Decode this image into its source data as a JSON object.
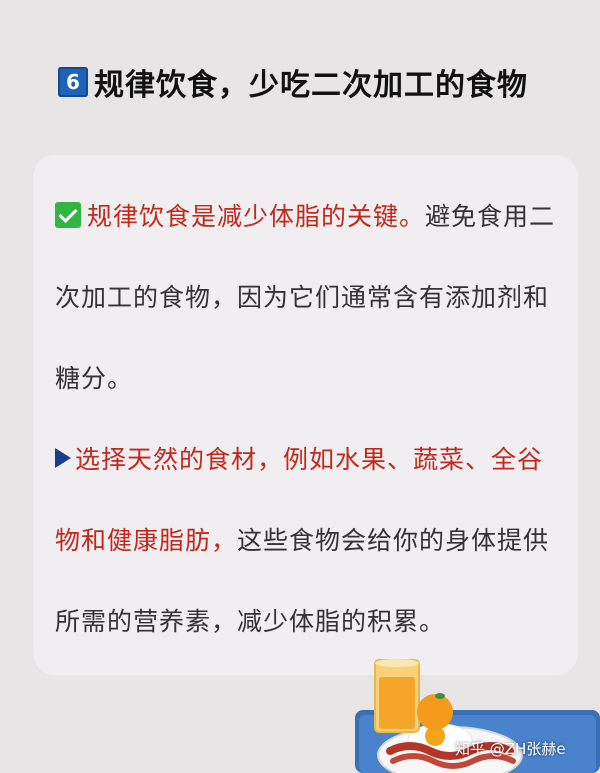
{
  "title": {
    "number": "6",
    "text": "规律饮食，少吃二次加工的食物"
  },
  "card": {
    "p1_highlight": "规律饮食是减少体脂的关键。",
    "p1_rest": "避免食用二次加工的食物，因为它们通常含有添加剂和糖分。",
    "p2_highlight": "选择天然的食材，例如水果、蔬菜、全谷物和健康脂肪，",
    "p2_rest": "这些食物会给你的身体提供所需的营养素，减少体脂的积累。"
  },
  "watermark": "知乎 @ZH张赫e",
  "icons": [
    "number-6-badge-icon",
    "check-mark-icon",
    "triangle-bullet-icon",
    "breakfast-illustration"
  ],
  "colors": {
    "background": "#e7e5e6",
    "card": "#f0eef0",
    "highlight": "#c0291c",
    "badge": "#1f63b9",
    "check": "#33b544"
  }
}
